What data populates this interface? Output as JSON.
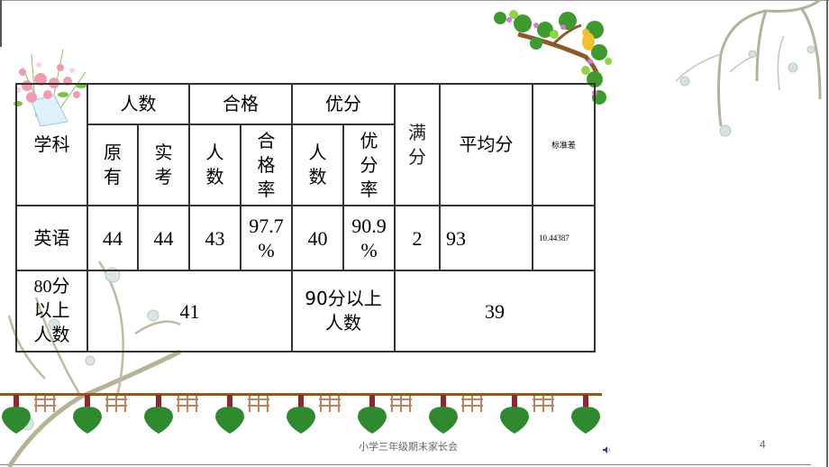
{
  "slide": {
    "footer": "小学三年级期末家长会",
    "page_number": "4",
    "audio_icon": "speaker-icon"
  },
  "table": {
    "header": {
      "subject": "学科",
      "group_count": "人数",
      "group_pass": "合格",
      "group_excellent": "优分",
      "full_score": [
        "满",
        "分"
      ],
      "average": "平均分",
      "std_dev": "标准差",
      "original": [
        "原",
        "有"
      ],
      "actual": [
        "实",
        "考"
      ],
      "pass_count": [
        "人",
        "数"
      ],
      "pass_rate": [
        "合",
        "格",
        "率"
      ],
      "excellent_count": [
        "人",
        "数"
      ],
      "excellent_rate": [
        "优",
        "分",
        "率"
      ]
    },
    "row": {
      "subject": "英语",
      "original": "44",
      "actual": "44",
      "pass_count": "43",
      "pass_rate": [
        "97.7",
        "%"
      ],
      "excellent_count": "40",
      "excellent_rate": [
        "90.9",
        "%"
      ],
      "full_score": "2",
      "average": "93",
      "std_dev": "10.44387"
    },
    "summary": {
      "above80_label": [
        "80分",
        "以上",
        "人数"
      ],
      "above80_value": "41",
      "above90_label": [
        "90分以上",
        "人数"
      ],
      "above90_value": "39"
    }
  }
}
